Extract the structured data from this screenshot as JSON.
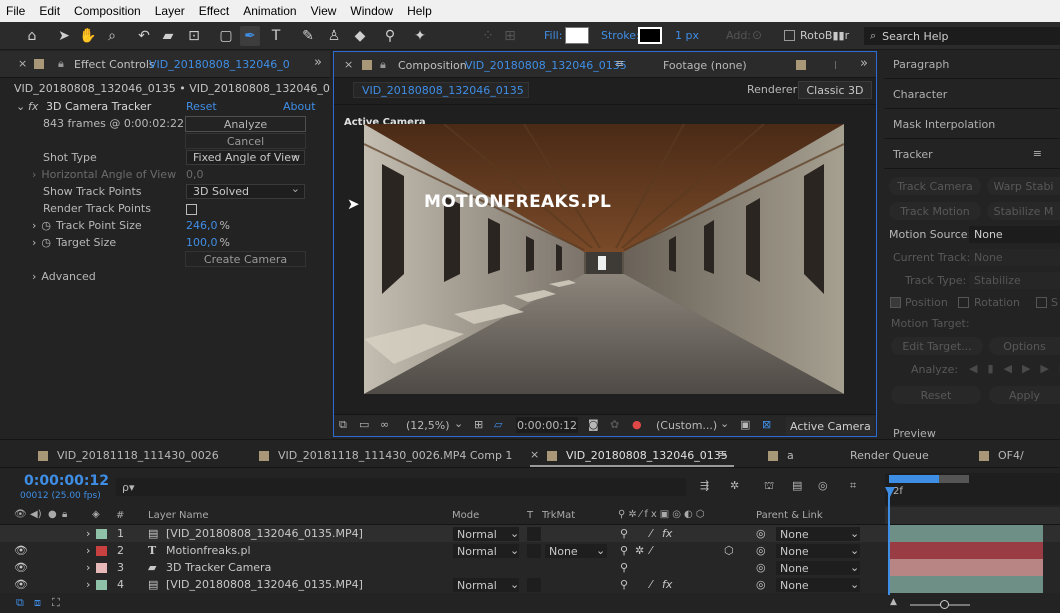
{
  "menu": [
    "File",
    "Edit",
    "Composition",
    "Layer",
    "Effect",
    "Animation",
    "View",
    "Window",
    "Help"
  ],
  "toolbar": {
    "fill_label": "Fill:",
    "stroke_label": "Stroke:",
    "stroke_px": "1 px",
    "add_label": "Add:",
    "roto_label": "RotoB▮▮r",
    "search_placeholder": "Search Help"
  },
  "effect_controls": {
    "tab_label": "Effect Controls",
    "tab_file": "VID_20180808_132046_0135",
    "path": "VID_20180808_132046_0135 • VID_20180808_132046_0135.MP4",
    "effect_name": "3D Camera Tracker",
    "reset": "Reset",
    "about": "About",
    "frames_info": "843 frames @ 0:00:02:22",
    "analyze": "Analyze",
    "cancel": "Cancel",
    "shot_type_label": "Shot Type",
    "shot_type_value": "Fixed Angle of View",
    "hav_label": "Horizontal Angle of View",
    "hav_value": "0,0",
    "show_tp_label": "Show Track Points",
    "show_tp_value": "3D Solved",
    "render_tp_label": "Render Track Points",
    "tps_label": "Track Point Size",
    "tps_value": "246,0",
    "tps_unit": "%",
    "ts_label": "Target Size",
    "ts_value": "100,0",
    "ts_unit": "%",
    "create_camera": "Create Camera",
    "advanced": "Advanced"
  },
  "composition": {
    "tab_label": "Composition",
    "tab_file": "VID_20180808_132046_0135",
    "footage_tab": "Footage (none)",
    "l_tab": "l",
    "subtab": "VID_20180808_132046_0135",
    "renderer_label": "Renderer:",
    "renderer_value": "Classic 3D",
    "active_camera_label": "Active Camera",
    "watermark": "MOTIONFREAKS.PL",
    "zoom": "(12,5%)",
    "timecode": "0:00:00:12",
    "resolution": "(Custom...)",
    "view": "Active Camera"
  },
  "right_panel": {
    "paragraph": "Paragraph",
    "character": "Character",
    "mask_interp": "Mask Interpolation",
    "tracker": "Tracker",
    "track_camera": "Track Camera",
    "warp_stab": "Warp Stabi",
    "track_motion": "Track Motion",
    "stabilize_m": "Stabilize M",
    "motion_source_label": "Motion Source:",
    "motion_source_value": "None",
    "current_track_label": "Current Track:",
    "current_track_value": "None",
    "track_type_label": "Track Type:",
    "track_type_value": "Stabilize",
    "position": "Position",
    "rotation": "Rotation",
    "scale_s": "S",
    "motion_target": "Motion Target:",
    "edit_target": "Edit Target...",
    "options": "Options",
    "analyze": "Analyze:",
    "reset": "Reset",
    "apply": "Apply",
    "preview": "Preview"
  },
  "timeline": {
    "tabs": [
      "VID_20181118_111430_0026",
      "VID_20181118_111430_0026.MP4 Comp 1",
      "VID_20180808_132046_0135",
      "a",
      "Render Queue",
      "OF4/"
    ],
    "tab_colors": [
      "#a89878",
      "#a89878",
      "#a89878",
      "#a89878",
      "#a89878"
    ],
    "timecode": "0:00:00:12",
    "fps": "00012 (25.00 fps)",
    "search_placeholder": "ρ▾",
    "ruler_mark": "2f",
    "headers": {
      "hash": "#",
      "layer_name": "Layer Name",
      "mode": "Mode",
      "t": "T",
      "trkmat": "TrkMat",
      "parent": "Parent & Link"
    },
    "layers": [
      {
        "num": "1",
        "name": "[VID_20180808_132046_0135.MP4]",
        "color": "#8fc0a8",
        "type": "footage",
        "mode": "Normal",
        "trkmat": "",
        "parent": "None",
        "bar": "#6e8f86"
      },
      {
        "num": "2",
        "name": "Motionfreaks.pl",
        "color": "#c84040",
        "type": "text",
        "mode": "Normal",
        "trkmat": "None",
        "parent": "None",
        "bar": "#9a3c44"
      },
      {
        "num": "3",
        "name": "3D Tracker Camera",
        "color": "#e6b8b8",
        "type": "camera",
        "mode": "",
        "trkmat": "",
        "parent": "None",
        "bar": "#b88484"
      },
      {
        "num": "4",
        "name": "[VID_20180808_132046_0135.MP4]",
        "color": "#8fc0a8",
        "type": "footage",
        "mode": "Normal",
        "trkmat": "",
        "parent": "None",
        "bar": "#6e8f86"
      }
    ]
  }
}
